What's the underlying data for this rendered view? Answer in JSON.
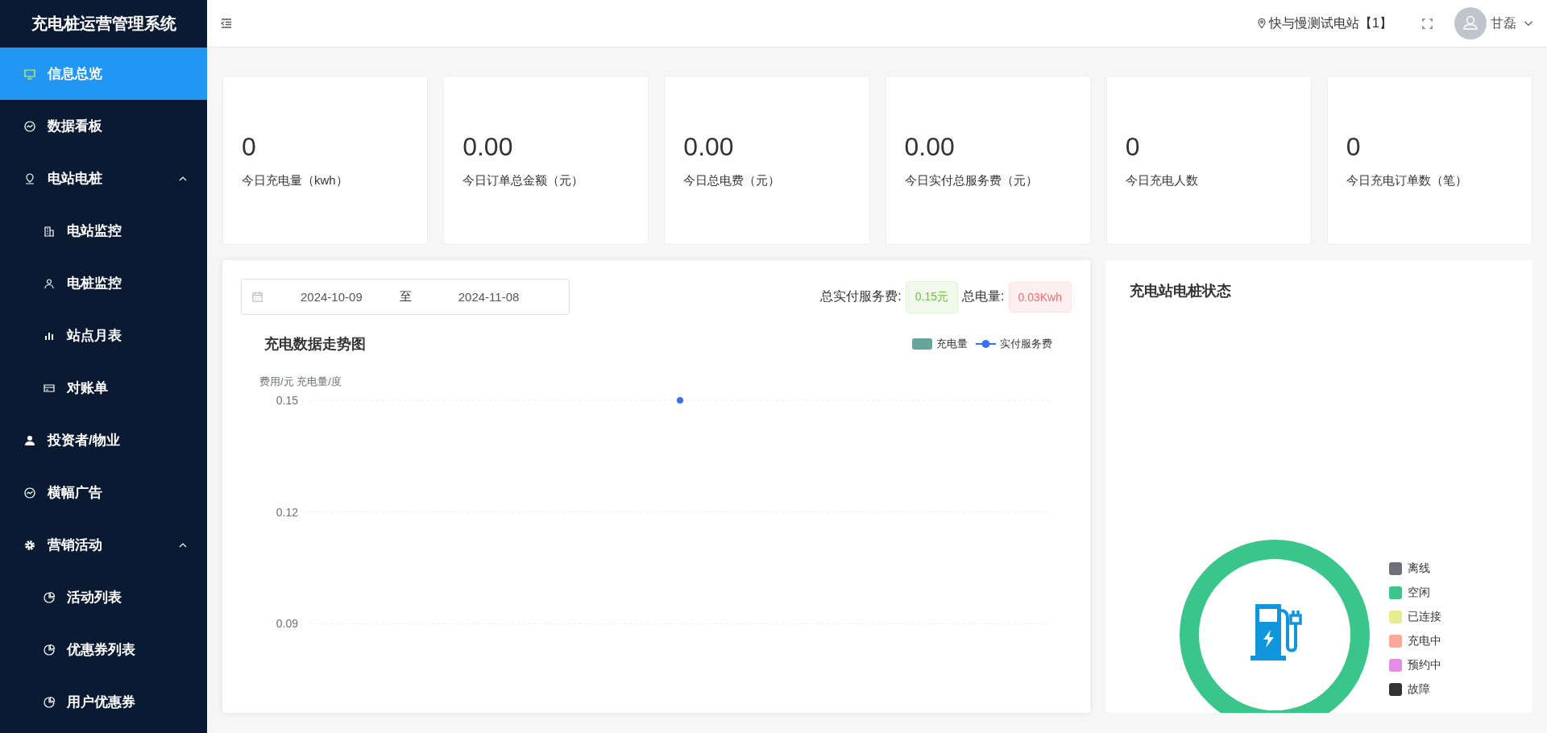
{
  "sidebar": {
    "title": "充电桩运营管理系统",
    "items": [
      {
        "label": "信息总览",
        "selected": true
      },
      {
        "label": "数据看板",
        "selected": false
      },
      {
        "label": "电站电桩",
        "selected": false,
        "expanded": true,
        "children": [
          {
            "label": "电站监控",
            "selected": false
          },
          {
            "label": "电桩监控",
            "selected": false
          },
          {
            "label": "站点月表",
            "selected": false
          },
          {
            "label": "对账单",
            "selected": false
          }
        ]
      },
      {
        "label": "投资者/物业",
        "selected": false
      },
      {
        "label": "横幅广告",
        "selected": false
      },
      {
        "label": "营销活动",
        "selected": false,
        "expanded": true,
        "children": [
          {
            "label": "活动列表",
            "selected": false
          },
          {
            "label": "优惠券列表",
            "selected": false
          },
          {
            "label": "用户优惠券",
            "selected": false
          }
        ]
      }
    ]
  },
  "header": {
    "station": "快与慢测试电站【1】",
    "user": "甘磊"
  },
  "stats": [
    {
      "value": "0",
      "label": "今日充电量（kwh）"
    },
    {
      "value": "0.00",
      "label": "今日订单总金额（元）"
    },
    {
      "value": "0.00",
      "label": "今日总电费（元）"
    },
    {
      "value": "0.00",
      "label": "今日实付总服务费（元）"
    },
    {
      "value": "0",
      "label": "今日充电人数"
    },
    {
      "value": "0",
      "label": "今日充电订单数（笔）"
    }
  ],
  "trend_card": {
    "date_range": {
      "start": "2024-10-09",
      "separator": "至",
      "end": "2024-11-08"
    },
    "totals": [
      {
        "label": "总实付服务费:",
        "value": "0.15元",
        "kind": "success"
      },
      {
        "label": "总电量:",
        "value": "0.03Kwh",
        "kind": "danger"
      }
    ],
    "chart_data": {
      "type": "line",
      "title": "充电数据走势图",
      "ylabel": "费用/元 充电量/度",
      "ylim": [
        0.09,
        0.15
      ],
      "yticks": [
        0.15,
        0.12,
        0.09
      ],
      "series": [
        {
          "name": "充电量",
          "color": "#67a59c",
          "values": [
            null
          ]
        },
        {
          "name": "实付服务费",
          "color": "#3b6ff5",
          "marker": true,
          "values": [
            0.15
          ]
        }
      ]
    }
  },
  "status_card": {
    "title": "充电站电桩状态",
    "legend": [
      {
        "label": "离线",
        "color": "#6e7079"
      },
      {
        "label": "空闲",
        "color": "#3ac68a"
      },
      {
        "label": "已连接",
        "color": "#e6ec8f"
      },
      {
        "label": "充电中",
        "color": "#fca797"
      },
      {
        "label": "预约中",
        "color": "#e48ee8"
      },
      {
        "label": "故障",
        "color": "#333333"
      }
    ]
  }
}
